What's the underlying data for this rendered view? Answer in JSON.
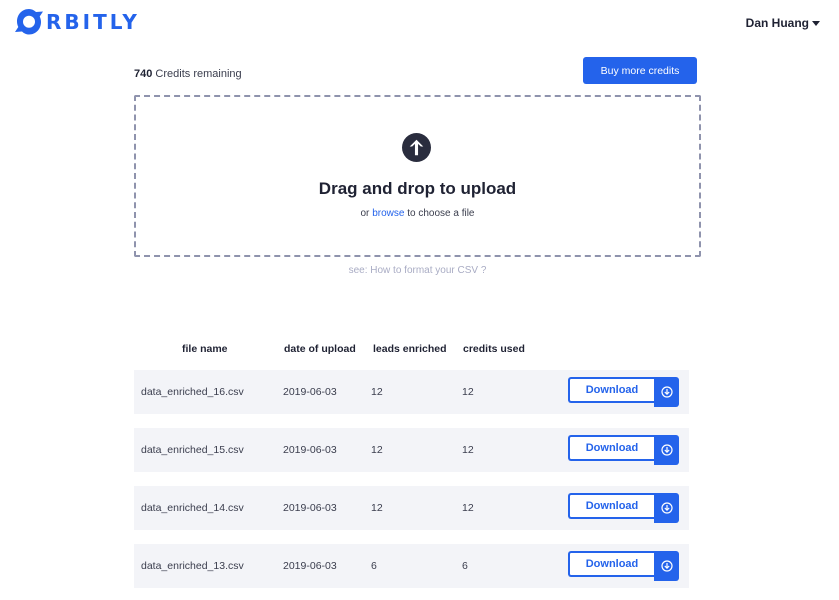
{
  "brand": {
    "logo_text": "RBITLY",
    "color": "#2463eb"
  },
  "user": {
    "name": "Dan Huang"
  },
  "credits": {
    "count": "740",
    "label": "Credits remaining"
  },
  "buy_button": {
    "label": "Buy more credits"
  },
  "dropzone": {
    "title": "Drag and drop to upload",
    "sub_prefix": "or",
    "browse_link": "browse",
    "sub_suffix": "to choose a file",
    "icon": "arrow-up-circle-icon"
  },
  "help": {
    "text": "see: How to format your CSV ?"
  },
  "table": {
    "headers": [
      "file name",
      "date of upload",
      "leads enriched",
      "credits used"
    ],
    "download_label": "Download",
    "rows": [
      {
        "file": "data_enriched_16.csv",
        "date": "2019-06-03",
        "leads": "12",
        "credits": "12"
      },
      {
        "file": "data_enriched_15.csv",
        "date": "2019-06-03",
        "leads": "12",
        "credits": "12"
      },
      {
        "file": "data_enriched_14.csv",
        "date": "2019-06-03",
        "leads": "12",
        "credits": "12"
      },
      {
        "file": "data_enriched_13.csv",
        "date": "2019-06-03",
        "leads": "6",
        "credits": "6"
      }
    ]
  }
}
